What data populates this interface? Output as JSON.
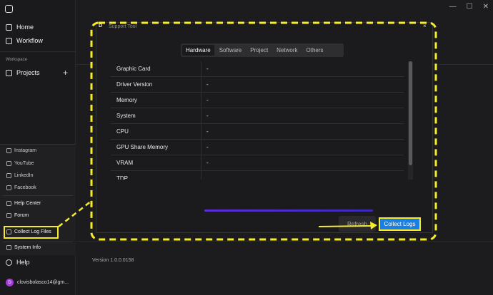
{
  "window": {
    "minimize": "—",
    "maximize": "☐",
    "close": "✕"
  },
  "sidebar": {
    "home": "Home",
    "workflow": "Workflow",
    "workspace_label": "Workspace",
    "projects": "Projects",
    "add": "+"
  },
  "menu": {
    "instagram": "Instagram",
    "youtube": "YouTube",
    "linkedin": "LinkedIn",
    "facebook": "Facebook",
    "help_center": "Help Center",
    "forum": "Forum",
    "collect_log_files": "Collect Log Files",
    "system_info": "System Info"
  },
  "help": "Help",
  "user": {
    "initial": "D",
    "email": "clovisbolasco14@gm..."
  },
  "version": "Version 1.0.0.0158",
  "dialog": {
    "logo": "D",
    "title": "Support Tool",
    "close": "×",
    "tabs": [
      "Hardware",
      "Software",
      "Project",
      "Network",
      "Others"
    ],
    "rows": [
      {
        "key": "Graphic Card",
        "value": "-"
      },
      {
        "key": "Driver Version",
        "value": "-"
      },
      {
        "key": "Memory",
        "value": "-"
      },
      {
        "key": "System",
        "value": "-"
      },
      {
        "key": "CPU",
        "value": "-"
      },
      {
        "key": "GPU Share Memory",
        "value": "-"
      },
      {
        "key": "VRAM",
        "value": "-"
      },
      {
        "key": "TDP",
        "value": ""
      }
    ],
    "refresh": "Refresh",
    "collect_logs": "Collect Logs"
  },
  "colors": {
    "annotation": "#f6ec2a",
    "primary": "#1a7fe0",
    "avatar": "#a03cd8"
  }
}
